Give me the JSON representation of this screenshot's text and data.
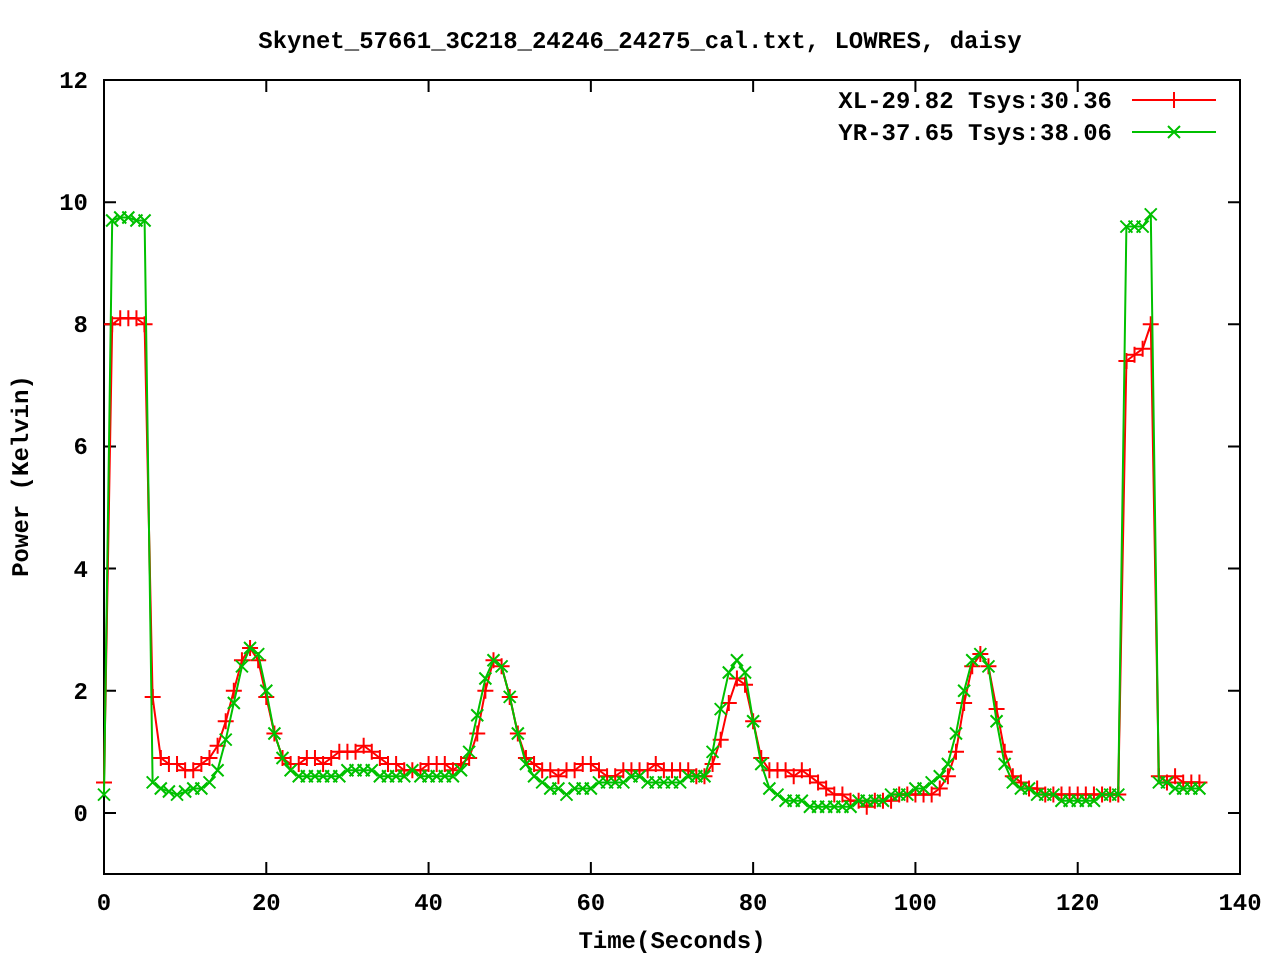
{
  "chart": {
    "chart_data": {
      "type": "line",
      "title": "Skynet_57661_3C218_24246_24275_cal.txt, LOWRES, daisy",
      "xlabel": "Time(Seconds)",
      "ylabel": "Power (Kelvin)",
      "legend": true,
      "xlim": [
        0,
        140
      ],
      "ylim": [
        -1,
        12
      ],
      "xticks": [
        0,
        20,
        40,
        60,
        80,
        100,
        120,
        140
      ],
      "yticks": [
        0,
        2,
        4,
        6,
        8,
        10,
        12
      ],
      "x": [
        0,
        1,
        2,
        3,
        4,
        5,
        6,
        7,
        8,
        9,
        10,
        11,
        12,
        13,
        14,
        15,
        16,
        17,
        18,
        19,
        20,
        21,
        22,
        23,
        24,
        25,
        26,
        27,
        28,
        29,
        30,
        31,
        32,
        33,
        34,
        35,
        36,
        37,
        38,
        39,
        40,
        41,
        42,
        43,
        44,
        45,
        46,
        47,
        48,
        49,
        50,
        51,
        52,
        53,
        54,
        55,
        56,
        57,
        58,
        59,
        60,
        61,
        62,
        63,
        64,
        65,
        66,
        67,
        68,
        69,
        70,
        71,
        72,
        73,
        74,
        75,
        76,
        77,
        78,
        79,
        80,
        81,
        82,
        83,
        84,
        85,
        86,
        87,
        88,
        89,
        90,
        91,
        92,
        93,
        94,
        95,
        96,
        97,
        98,
        99,
        100,
        101,
        102,
        103,
        104,
        105,
        106,
        107,
        108,
        109,
        110,
        111,
        112,
        113,
        114,
        115,
        116,
        117,
        118,
        119,
        120,
        121,
        122,
        123,
        124,
        125,
        126,
        127,
        128,
        129,
        130,
        131,
        132,
        133,
        134,
        135
      ],
      "series": [
        {
          "name": "XL-29.82 Tsys:30.36",
          "color": "#ff0000",
          "marker": "plus",
          "values": [
            0.5,
            8.0,
            8.1,
            8.1,
            8.1,
            8.0,
            1.9,
            0.9,
            0.8,
            0.8,
            0.7,
            0.7,
            0.8,
            0.9,
            1.1,
            1.5,
            2.0,
            2.5,
            2.7,
            2.5,
            1.9,
            1.3,
            0.9,
            0.8,
            0.8,
            0.9,
            0.9,
            0.8,
            0.9,
            1.0,
            1.0,
            1.0,
            1.1,
            1.0,
            0.9,
            0.8,
            0.8,
            0.7,
            0.7,
            0.7,
            0.8,
            0.8,
            0.8,
            0.7,
            0.8,
            0.9,
            1.3,
            2.0,
            2.5,
            2.4,
            1.9,
            1.3,
            0.9,
            0.8,
            0.7,
            0.7,
            0.6,
            0.7,
            0.7,
            0.8,
            0.8,
            0.7,
            0.6,
            0.6,
            0.7,
            0.7,
            0.7,
            0.7,
            0.8,
            0.7,
            0.7,
            0.7,
            0.7,
            0.6,
            0.6,
            0.8,
            1.2,
            1.8,
            2.2,
            2.1,
            1.5,
            0.9,
            0.7,
            0.7,
            0.7,
            0.6,
            0.7,
            0.6,
            0.5,
            0.4,
            0.3,
            0.3,
            0.2,
            0.2,
            0.1,
            0.2,
            0.2,
            0.2,
            0.3,
            0.3,
            0.3,
            0.3,
            0.3,
            0.4,
            0.6,
            1.0,
            1.8,
            2.4,
            2.6,
            2.4,
            1.7,
            1.0,
            0.6,
            0.5,
            0.4,
            0.4,
            0.3,
            0.3,
            0.3,
            0.3,
            0.3,
            0.3,
            0.3,
            0.3,
            0.3,
            0.3,
            7.4,
            7.5,
            7.6,
            8.0,
            0.6,
            0.5,
            0.6,
            0.5,
            0.5,
            0.5
          ]
        },
        {
          "name": "YR-37.65 Tsys:38.06",
          "color": "#00c000",
          "marker": "cross",
          "values": [
            0.3,
            9.7,
            9.75,
            9.75,
            9.7,
            9.7,
            0.5,
            0.4,
            0.35,
            0.3,
            0.35,
            0.4,
            0.4,
            0.5,
            0.7,
            1.2,
            1.8,
            2.4,
            2.7,
            2.6,
            2.0,
            1.3,
            0.9,
            0.7,
            0.6,
            0.6,
            0.6,
            0.6,
            0.6,
            0.6,
            0.7,
            0.7,
            0.7,
            0.7,
            0.6,
            0.6,
            0.6,
            0.6,
            0.7,
            0.6,
            0.6,
            0.6,
            0.6,
            0.6,
            0.7,
            1.0,
            1.6,
            2.2,
            2.5,
            2.4,
            1.9,
            1.3,
            0.8,
            0.6,
            0.5,
            0.4,
            0.4,
            0.3,
            0.4,
            0.4,
            0.4,
            0.5,
            0.5,
            0.5,
            0.5,
            0.6,
            0.6,
            0.5,
            0.5,
            0.5,
            0.5,
            0.5,
            0.6,
            0.6,
            0.6,
            1.0,
            1.7,
            2.3,
            2.5,
            2.3,
            1.5,
            0.8,
            0.4,
            0.3,
            0.2,
            0.2,
            0.2,
            0.1,
            0.1,
            0.1,
            0.1,
            0.1,
            0.1,
            0.2,
            0.2,
            0.2,
            0.2,
            0.3,
            0.3,
            0.3,
            0.4,
            0.4,
            0.5,
            0.6,
            0.8,
            1.3,
            2.0,
            2.5,
            2.6,
            2.4,
            1.5,
            0.8,
            0.5,
            0.4,
            0.4,
            0.3,
            0.3,
            0.3,
            0.2,
            0.2,
            0.2,
            0.2,
            0.2,
            0.3,
            0.3,
            0.3,
            9.6,
            9.6,
            9.6,
            9.8,
            0.5,
            0.5,
            0.4,
            0.4,
            0.4,
            0.4
          ]
        }
      ]
    }
  }
}
